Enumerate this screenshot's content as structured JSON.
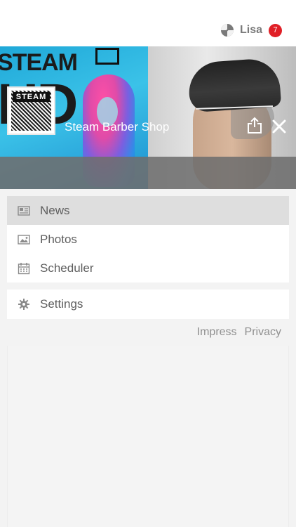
{
  "header": {
    "user_name": "Lisa",
    "notification_count": "7",
    "accent_color": "#e01f26"
  },
  "hero": {
    "left_image_text_line1": "STEAM",
    "left_image_text_line2": "HD",
    "logo_text": "STEAM",
    "shop_name": "Steam Barber Shop"
  },
  "menu": {
    "items": [
      {
        "label": "News",
        "icon": "newspaper-icon",
        "active": true
      },
      {
        "label": "Photos",
        "icon": "image-icon",
        "active": false
      },
      {
        "label": "Scheduler",
        "icon": "calendar-icon",
        "active": false
      }
    ]
  },
  "settings": {
    "label": "Settings",
    "icon": "gear-icon"
  },
  "footer": {
    "impress": "Impress",
    "privacy": "Privacy"
  }
}
